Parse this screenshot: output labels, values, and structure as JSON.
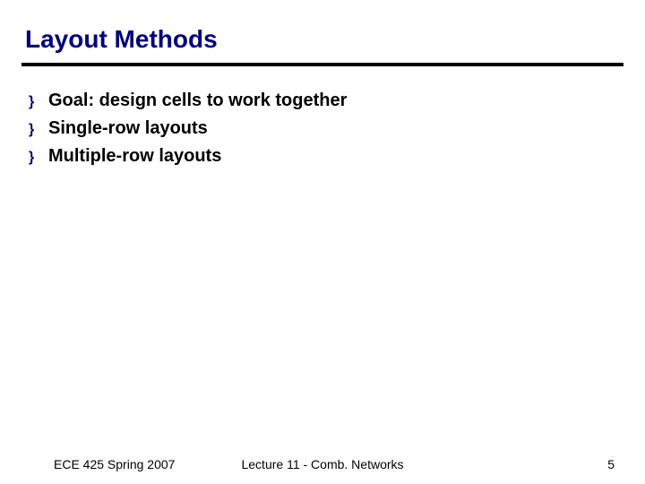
{
  "title": "Layout Methods",
  "bullets": [
    "Goal: design cells to work together",
    "Single-row layouts",
    "Multiple-row layouts"
  ],
  "bullet_marker": "}",
  "footer": {
    "left": "ECE 425 Spring 2007",
    "center": "Lecture 11 - Comb. Networks",
    "right": "5"
  }
}
